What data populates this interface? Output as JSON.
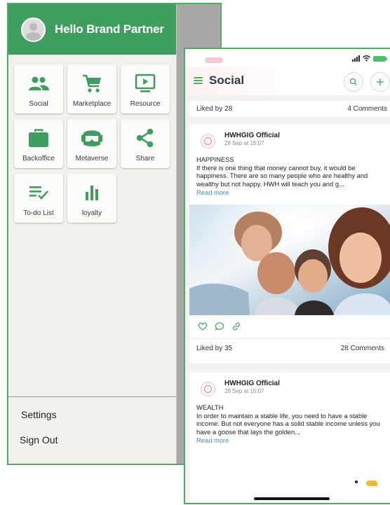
{
  "drawer": {
    "greeting": "Hello Brand Partner",
    "tiles": [
      {
        "label": "Social",
        "icon": "people-icon"
      },
      {
        "label": "Marketplace",
        "icon": "cart-icon"
      },
      {
        "label": "Resource",
        "icon": "monitor-play-icon"
      },
      {
        "label": "Backoffice",
        "icon": "briefcase-icon"
      },
      {
        "label": "Metaverse",
        "icon": "vr-headset-icon"
      },
      {
        "label": "Share",
        "icon": "share-icon"
      },
      {
        "label": "To-do List",
        "icon": "checklist-icon"
      },
      {
        "label": "loyalty",
        "icon": "bar-chart-icon"
      }
    ],
    "settings_label": "Settings",
    "signout_label": "Sign Out",
    "colors": {
      "header": "#3f9d5f",
      "icon": "#3f9d5f",
      "frame": "#4cae5a"
    }
  },
  "social": {
    "title": "Social",
    "prev_post": {
      "likes": "Liked by 28",
      "comments": "4 Comments"
    },
    "posts": [
      {
        "author": "HWHGIG Official",
        "time": "28 Sep at 15:07",
        "heading": "HAPPINESS",
        "text": "If there is one thing that money cannot buy, it would be happiness. There are so many people who are healthy and wealthy but not happy. HWH will teach you and g...",
        "read_more": "Read more",
        "likes": "Liked by 35",
        "comments": "28 Comments"
      },
      {
        "author": "HWHGIG Official",
        "time": "28 Sep at 15:07",
        "heading": "WEALTH",
        "text": "In order to maintain a stable life, you need to have a stable income. But not everyone has a solid stable income unless you have a goose that lays the golden...",
        "read_more": "Read more"
      }
    ],
    "colors": {
      "accent": "#4cae5a",
      "link": "#3e8fd4",
      "title": "#2b3a4a"
    }
  }
}
